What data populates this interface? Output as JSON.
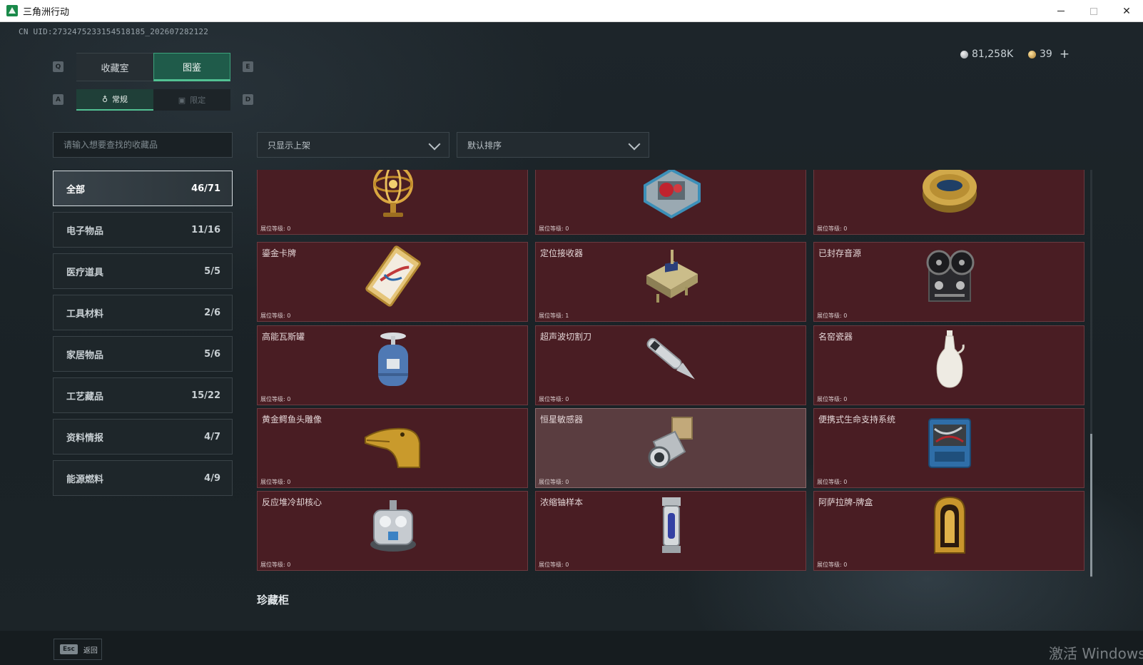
{
  "window": {
    "title": "三角洲行动"
  },
  "uid": "CN UID:2732475233154518185_202607282122",
  "currency": {
    "silver": "81,258K",
    "gold": "39",
    "plus": "+"
  },
  "keys": {
    "q": "Q",
    "e": "E",
    "a": "A",
    "d": "D"
  },
  "tabs": {
    "main": [
      "收藏室",
      "图鉴"
    ],
    "sub": [
      "常规",
      "限定"
    ]
  },
  "search": {
    "placeholder": "请输入想要查找的收藏品"
  },
  "filters": {
    "shelf": "只显示上架",
    "sort": "默认排序"
  },
  "categories": [
    {
      "label": "全部",
      "count": "46/71"
    },
    {
      "label": "电子物品",
      "count": "11/16"
    },
    {
      "label": "医疗道具",
      "count": "5/5"
    },
    {
      "label": "工具材料",
      "count": "2/6"
    },
    {
      "label": "家居物品",
      "count": "5/6"
    },
    {
      "label": "工艺藏品",
      "count": "15/22"
    },
    {
      "label": "资料情报",
      "count": "4/7"
    },
    {
      "label": "能源燃料",
      "count": "4/9"
    }
  ],
  "items": [
    {
      "name": "",
      "level": "展位等级: 0",
      "icon": "armillary-sphere-icon"
    },
    {
      "name": "",
      "level": "展位等级: 0",
      "icon": "heart-device-icon"
    },
    {
      "name": "",
      "level": "展位等级: 0",
      "icon": "caviar-tin-icon"
    },
    {
      "name": "鎏金卡牌",
      "level": "展位等级: 0",
      "icon": "gilded-card-icon"
    },
    {
      "name": "定位接收器",
      "level": "展位等级: 1",
      "icon": "receiver-icon"
    },
    {
      "name": "已封存音源",
      "level": "展位等级: 0",
      "icon": "reel-recorder-icon"
    },
    {
      "name": "高能瓦斯罐",
      "level": "展位等级: 0",
      "icon": "gas-tank-icon"
    },
    {
      "name": "超声波切割刀",
      "level": "展位等级: 0",
      "icon": "ultrasonic-knife-icon"
    },
    {
      "name": "名窑瓷器",
      "level": "展位等级: 0",
      "icon": "porcelain-vase-icon"
    },
    {
      "name": "黄金鳄鱼头雕像",
      "level": "展位等级: 0",
      "icon": "crocodile-statue-icon"
    },
    {
      "name": "恒星敏感器",
      "level": "展位等级: 0",
      "icon": "star-sensor-icon"
    },
    {
      "name": "便携式生命支持系统",
      "level": "展位等级: 0",
      "icon": "life-support-icon"
    },
    {
      "name": "反应堆冷却核心",
      "level": "展位等级: 0",
      "icon": "reactor-core-icon"
    },
    {
      "name": "浓缩铀样本",
      "level": "展位等级: 0",
      "icon": "uranium-sample-icon"
    },
    {
      "name": "阿萨拉牌-牌盒",
      "level": "展位等级: 0",
      "icon": "card-box-icon"
    }
  ],
  "section": "珍藏柜",
  "footer": {
    "esc_key": "Esc",
    "esc_label": "返回"
  },
  "watermark": "激活 Windows"
}
